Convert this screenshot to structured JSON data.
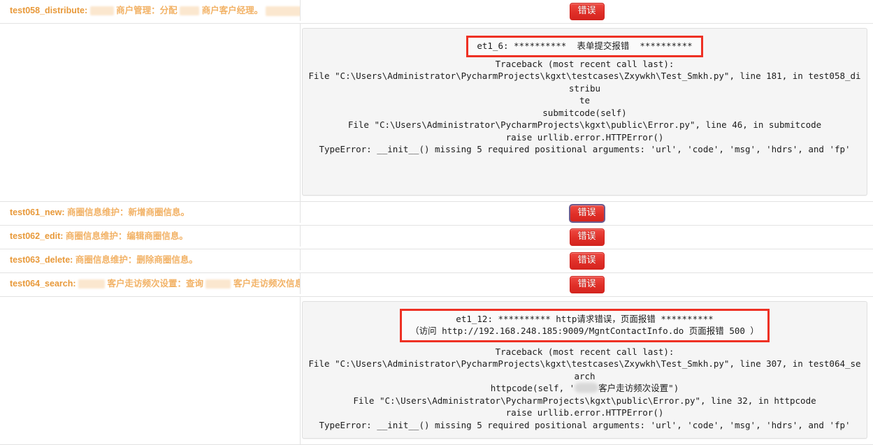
{
  "badge_label": "错误",
  "colors": {
    "badge_red": "#e02f28",
    "highlight_border_red": "#ee3124",
    "case_name_orange": "#e8993a",
    "panel_bg": "#f5f5f5"
  },
  "rows": [
    {
      "id": "test058_distribute:",
      "desc_before": "商户管理：分配",
      "desc_after": "商户客户经理。",
      "status": "错误",
      "focused": true,
      "redacted": true
    },
    {
      "id": "test061_new:",
      "desc_before": "商圈信息维护：新增商圈信息。",
      "desc_after": "",
      "status": "错误",
      "focused": true,
      "redacted": false
    },
    {
      "id": "test062_edit:",
      "desc_before": "商圈信息维护：编辑商圈信息。",
      "desc_after": "",
      "status": "错误",
      "focused": false,
      "redacted": false
    },
    {
      "id": "test063_delete:",
      "desc_before": "商圈信息维护：删除商圈信息。",
      "desc_after": "",
      "status": "错误",
      "focused": false,
      "redacted": false
    },
    {
      "id": "test064_search:",
      "desc_before": "客户走访频次设置：查询",
      "desc_after": "客户走访频次信息。",
      "status": "错误",
      "focused": false,
      "redacted": true
    }
  ],
  "traceback_1": {
    "headline": "et1_6: **********  表单提交报错  **********",
    "body_line_1": "Traceback (most recent call last):",
    "body_line_2": "File \"C:\\Users\\Administrator\\PycharmProjects\\kgxt\\testcases\\Zxywkh\\Test_Smkh.py\", line 181, in test058_distribu",
    "body_line_3": "te",
    "body_line_4": "submitcode(self)",
    "body_line_5": "File \"C:\\Users\\Administrator\\PycharmProjects\\kgxt\\public\\Error.py\", line 46, in submitcode",
    "body_line_6": "raise urllib.error.HTTPError()",
    "body_line_7": "TypeError: __init__() missing 5 required positional arguments: 'url', 'code', 'msg', 'hdrs', and 'fp'"
  },
  "traceback_2": {
    "headline_line_1": "et1_12: ********** http请求错误，页面报错 **********",
    "headline_line_2": "（访问 http://192.168.248.185:9009/MgntContactInfo.do 页面报错 500 ）",
    "body_line_1": "Traceback (most recent call last):",
    "body_line_2": "File \"C:\\Users\\Administrator\\PycharmProjects\\kgxt\\testcases\\Zxywkh\\Test_Smkh.py\", line 307, in test064_search",
    "body_line_3_pre": "httpcode(self, '",
    "body_line_3_post": "客户走访频次设置\")",
    "body_line_4": "File \"C:\\Users\\Administrator\\PycharmProjects\\kgxt\\public\\Error.py\", line 32, in httpcode",
    "body_line_5": "raise urllib.error.HTTPError()",
    "body_line_6": "TypeError: __init__() missing 5 required positional arguments: 'url', 'code', 'msg', 'hdrs', and 'fp'"
  }
}
